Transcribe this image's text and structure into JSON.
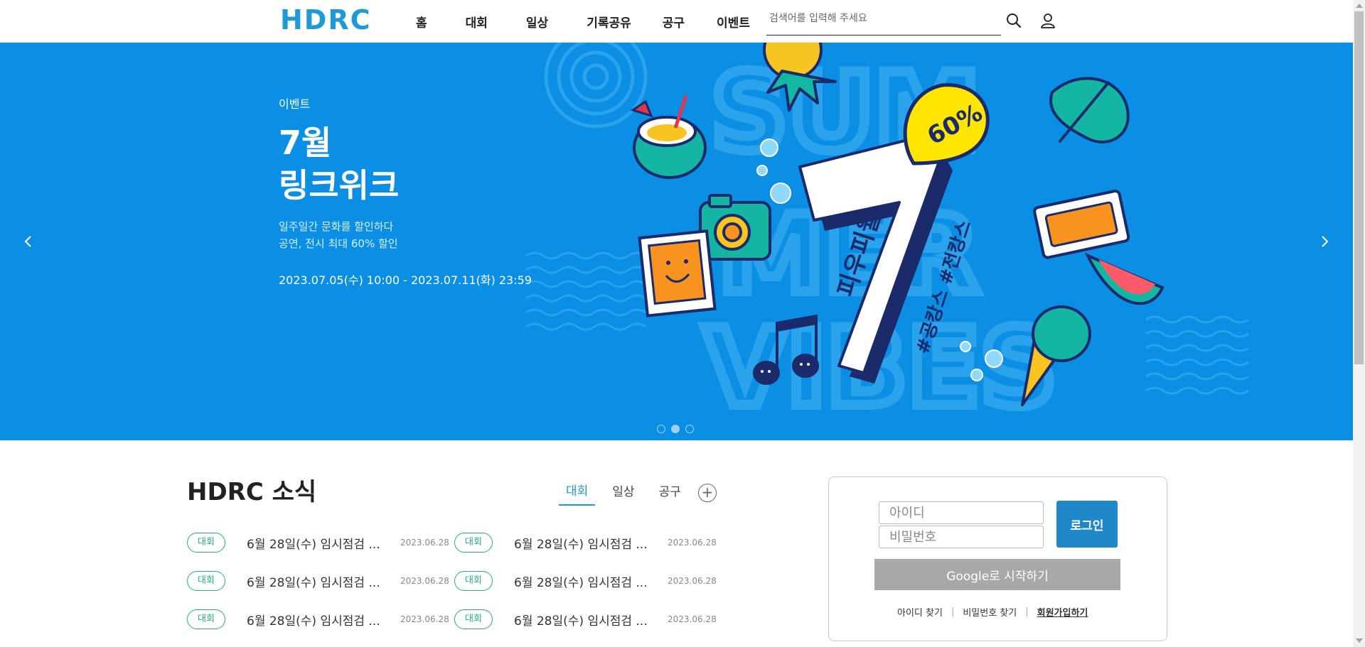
{
  "header": {
    "logo": "HDRC",
    "nav": [
      "홈",
      "대회",
      "일상",
      "기록공유",
      "공구",
      "이벤트"
    ],
    "search_placeholder": "검색어를 입력해 주세요",
    "search_icon": "search-icon",
    "user_icon": "user-icon"
  },
  "banner": {
    "category": "이벤트",
    "title_line1": "7월",
    "title_line2": "링크위크",
    "sub_line1": "일주일간 문화를 할인하다",
    "sub_line2": "공연, 전시 최대 60% 할인",
    "date": "2023.07.05(수) 10:00 - 2023.07.11(화) 23:59",
    "art_number": "7",
    "art_badge": "60%",
    "art_vertical_1": "피우피월",
    "art_vertical_2": "#공캉스 #전캉스",
    "art_bg_words": [
      "SUM",
      "MER",
      "VIBES"
    ],
    "prev_icon": "chevron-left-icon",
    "next_icon": "chevron-right-icon",
    "slide_count": 3,
    "active_slide": 2,
    "colors": {
      "bg": "#0a8fe4",
      "accent": "#ffe600",
      "navy": "#1b2a6b"
    }
  },
  "news": {
    "title": "HDRC 소식",
    "tabs": [
      "대회",
      "일상",
      "공구"
    ],
    "active_tab": "대회",
    "plus_label": "+",
    "items": [
      {
        "badge": "대회",
        "text": "6월 28일(수) 임시점검 ...",
        "date": "2023.06.28"
      },
      {
        "badge": "대회",
        "text": "6월 28일(수) 임시점검 ...",
        "date": "2023.06.28"
      },
      {
        "badge": "대회",
        "text": "6월 28일(수) 임시점검 ...",
        "date": "2023.06.28"
      },
      {
        "badge": "대회",
        "text": "6월 28일(수) 임시점검 ...",
        "date": "2023.06.28"
      },
      {
        "badge": "대회",
        "text": "6월 28일(수) 임시점검 ...",
        "date": "2023.06.28"
      },
      {
        "badge": "대회",
        "text": "6월 28일(수) 임시점검 ...",
        "date": "2023.06.28"
      }
    ]
  },
  "login": {
    "id_placeholder": "아이디",
    "pw_placeholder": "비밀번호",
    "login_label": "로그인",
    "google_label": "Google로 시작하기",
    "find_id": "아이디 찾기",
    "find_pw": "비밀번호 찾기",
    "signup": "회원가입하기"
  }
}
